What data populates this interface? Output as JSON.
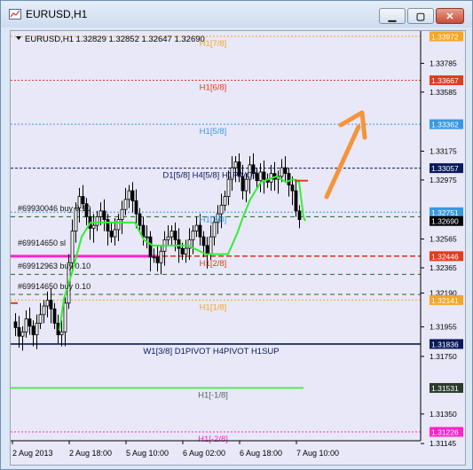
{
  "window": {
    "title": "EURUSD,H1"
  },
  "symbol_info": "EURUSD,H1  1.32829 1.32852 1.32647 1.32690",
  "price_axis": {
    "ticks": [
      "1.33785",
      "1.33585",
      "1.33175",
      "1.32975",
      "1.32565",
      "1.32365",
      "1.32190",
      "1.31955",
      "1.31750",
      "1.31350",
      "1.31145"
    ]
  },
  "price_tags": [
    {
      "price": 1.33972,
      "label": "1.33972",
      "color": "#f5a623"
    },
    {
      "price": 1.33667,
      "label": "1.33667",
      "color": "#e03c1e"
    },
    {
      "price": 1.33362,
      "label": "1.33362",
      "color": "#3a98e0"
    },
    {
      "price": 1.33057,
      "label": "1.33057",
      "color": "#0a1a5a"
    },
    {
      "price": 1.32751,
      "label": "1.32751",
      "color": "#3a98e0"
    },
    {
      "price": 1.3269,
      "label": "1.32690",
      "color": "#000000"
    },
    {
      "price": 1.32446,
      "label": "1.32446",
      "color": "#e03c1e"
    },
    {
      "price": 1.32141,
      "label": "1.32141",
      "color": "#f5a623"
    },
    {
      "price": 1.31836,
      "label": "1.31836",
      "color": "#0a1a5a"
    },
    {
      "price": 1.31531,
      "label": "1.31531",
      "color": "#2a3a2a"
    },
    {
      "price": 1.31226,
      "label": "1.31226",
      "color": "#ff22cc"
    }
  ],
  "level_labels": [
    {
      "text": "H1[7/8]",
      "price": 1.33972,
      "color": "#f5a623"
    },
    {
      "text": "H1[6/8]",
      "price": 1.33667,
      "color": "#e03c1e"
    },
    {
      "text": "H1[5/8]",
      "price": 1.33362,
      "color": "#3a98e0"
    },
    {
      "text": "D1[5/8] H4[5/8] H1PIVOT",
      "price": 1.33057,
      "color": "#0a1a5a"
    },
    {
      "text": "H1[3/8]",
      "price": 1.32751,
      "color": "#3a98e0"
    },
    {
      "text": "H1[2/8]",
      "price": 1.32446,
      "color": "#e03c1e"
    },
    {
      "text": "H1[1/8]",
      "price": 1.32141,
      "color": "#f5a623"
    },
    {
      "text": "W1[3/8] D1PIVOT H4PIVOT H1SUP",
      "price": 1.31836,
      "color": "#0a1a5a"
    },
    {
      "text": "H1[-1/8]",
      "price": 1.31531,
      "color": "#556655"
    },
    {
      "text": "H1[-2/8]",
      "price": 1.31226,
      "color": "#ff22cc"
    }
  ],
  "orders": [
    {
      "text": "#69930046 buy 0.10"
    },
    {
      "text": "#69914650 sl"
    },
    {
      "text": "#69912963 buy 0.10"
    },
    {
      "text": "#69914650 buy 0.10"
    }
  ],
  "time_axis": {
    "labels": [
      "2 Aug 2013",
      "2 Aug 18:00",
      "5 Aug 10:00",
      "6 Aug 02:00",
      "6 Aug 18:00",
      "7 Aug 10:00"
    ]
  },
  "colors": {
    "background": "#e8e8f8",
    "candles": "#000000",
    "trailing_line": "#33ee33",
    "arrow": "#f5943a"
  }
}
